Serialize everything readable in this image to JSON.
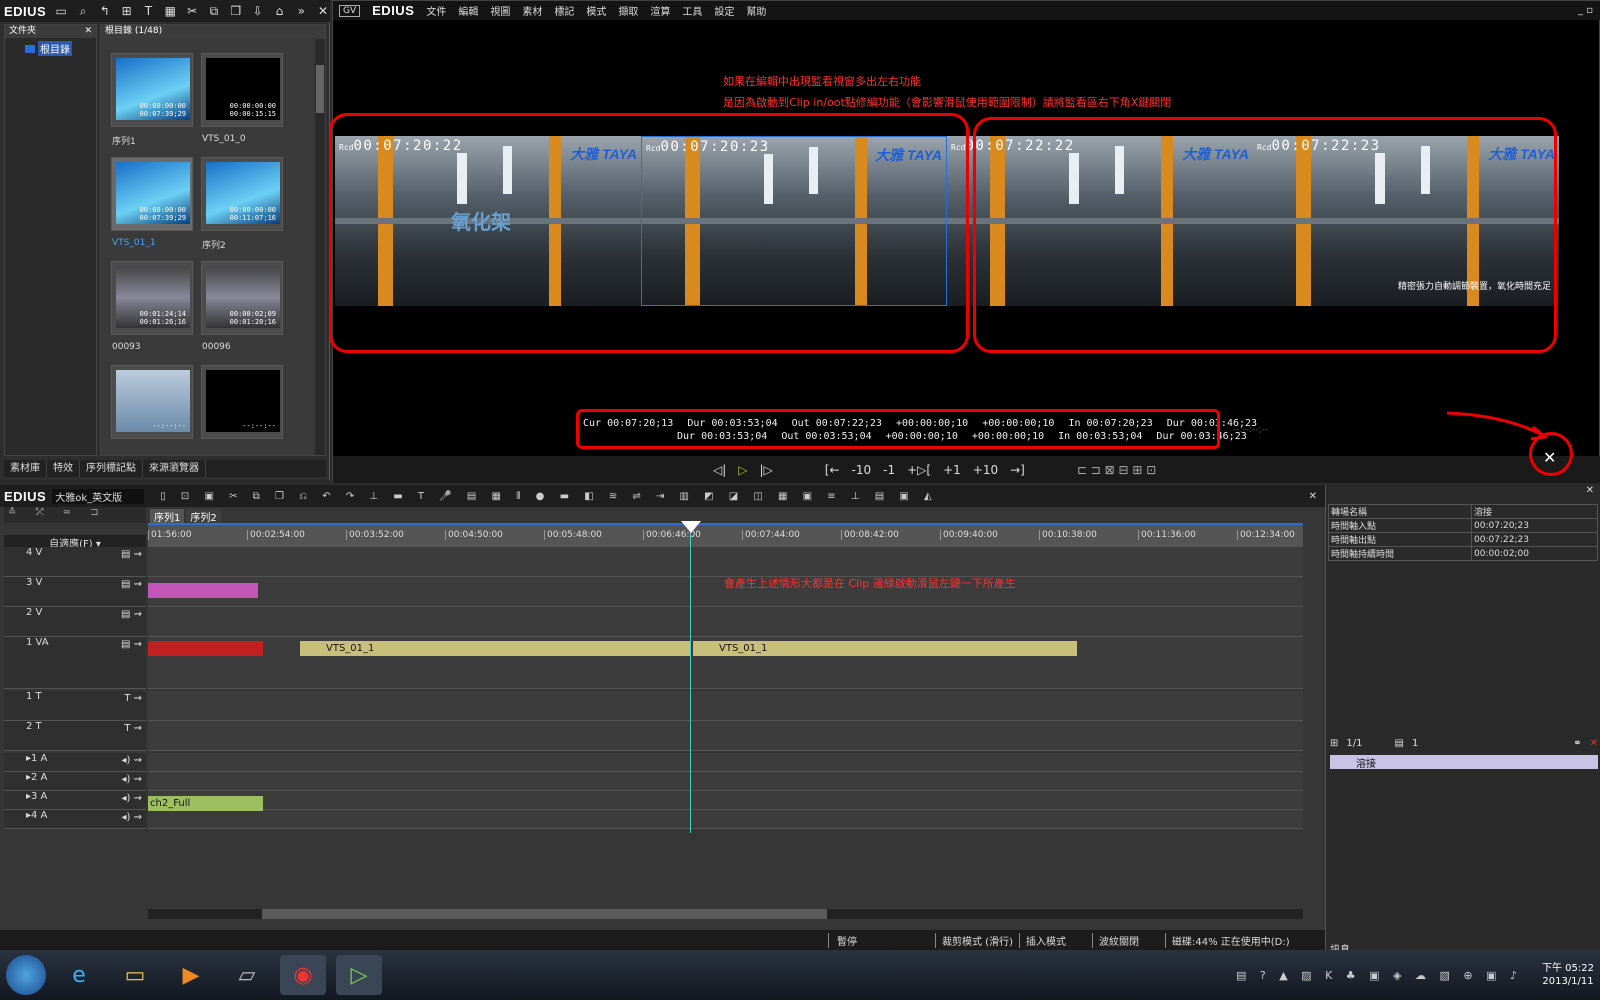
{
  "bin": {
    "logo": "EDIUS",
    "folder_header": "文件夾",
    "root_folder": "根目錄",
    "clip_header": "根目錄 (1/48)",
    "clips": [
      {
        "label": "序列1",
        "tc": "00:00:00:00\n00:07:39;29",
        "kind": "seq"
      },
      {
        "label": "VTS_01_0",
        "tc": "00:00:00:00\n00:00:15:15",
        "kind": "dark"
      },
      {
        "label": "VTS_01_1",
        "tc": "00:00:00:00\n00:07:39;29",
        "kind": "blue",
        "selected": true
      },
      {
        "label": "序列2",
        "tc": "00:00:00:00\n00:11:07;16",
        "kind": "seq"
      },
      {
        "label": "00093",
        "tc": "00:01:24;14\n00:01:26;16",
        "kind": "photo"
      },
      {
        "label": "00096",
        "tc": "00:00:02;09\n00:01:20;16",
        "kind": "photo"
      },
      {
        "label": "",
        "tc": "--:--:--",
        "kind": "still"
      },
      {
        "label": "",
        "tc": "--:--:--",
        "kind": "title"
      }
    ],
    "tabs": [
      "素材庫",
      "特效",
      "序列標記點",
      "來源瀏覽器"
    ]
  },
  "recorder": {
    "logo": "EDIUS",
    "menus": [
      "文件",
      "編輯",
      "視圖",
      "素材",
      "標記",
      "模式",
      "擷取",
      "渲算",
      "工具",
      "設定",
      "幫助"
    ],
    "note_line1": "如果在編輯中出現監看視窗多出左右功能",
    "note_line2": "是因為啟動到Clip in/oot點修編功能（會影響滑鼠使用範圍限制）請將監看區右下角X鍵關閉",
    "frames": [
      {
        "rcd": "Rcd",
        "tc": "00:07:20:22",
        "logo": "大雅 TAYA",
        "overlay": "氧化架",
        "caption": ""
      },
      {
        "rcd": "Rcd",
        "tc": "00:07:20:23",
        "logo": "大雅 TAYA",
        "overlay": "",
        "caption": ""
      },
      {
        "rcd": "Rcd",
        "tc": "00:07:22:22",
        "logo": "大雅 TAYA",
        "overlay": "",
        "caption": ""
      },
      {
        "rcd": "Rcd",
        "tc": "00:07:22:23",
        "logo": "大雅 TAYA",
        "overlay": "",
        "caption": "精密張力自動調節裝置，氧化時間充足"
      }
    ],
    "tc_rows": [
      [
        "Cur 00:07:20;13",
        "Dur 00:03:53;04",
        "Out 00:07:22;23",
        "+00:00:00;10",
        "+00:00:00;10",
        "In 00:07:20;23",
        "Dur 00:03:46;23"
      ],
      [
        "",
        "Dur 00:03:53;04",
        "Out 00:03:53;04",
        "+00:00:00;10",
        "+00:00:00;10",
        "In 00:03:53;04",
        "Dur 00:03:46;23"
      ]
    ],
    "tc_tail": "--:--:--;--",
    "transport": [
      "◁|",
      "▷",
      "|▷",
      "[←",
      "-10",
      "-1",
      "+▷[",
      "+1",
      "+10",
      "→]"
    ],
    "close": "✕"
  },
  "timeline": {
    "logo": "EDIUS",
    "project": "大雅ok_英文版",
    "tabs": [
      "序列1",
      "序列2"
    ],
    "fit": "自適應(F)",
    "ruler": [
      "01:56:00",
      "00:02:54:00",
      "00:03:52:00",
      "00:04:50:00",
      "00:05:48:00",
      "00:06:46:00",
      "00:07:44:00",
      "00:08:42:00",
      "00:09:40:00",
      "00:10:38:00",
      "00:11:36:00",
      "00:12:34:00"
    ],
    "note": "會產生上述情形大都是在 Clip 邊緣啟動滑鼠左鍵一下所產生",
    "tracks": [
      "4 V",
      "3 V",
      "2 V",
      "1 VA",
      "1 T",
      "2 T",
      "▸1 A",
      "▸2 A",
      "▸3 A",
      "▸4 A"
    ],
    "clips": [
      "VTS_01_1",
      "VTS_01_1",
      "ch2_Full"
    ]
  },
  "info": {
    "rows": [
      [
        "轉場名稱",
        "溶接"
      ],
      [
        "時間軸入點",
        "00:07:20;23"
      ],
      [
        "時間軸出點",
        "00:07:22;23"
      ],
      [
        "時間軸持續時間",
        "00:00:02;00"
      ]
    ],
    "page": "1/1",
    "count": "1",
    "item": "溶接",
    "tab": "訊息"
  },
  "status": {
    "items": [
      "暫停",
      "裁剪模式 (滑行)",
      "插入模式",
      "波紋關閉",
      "磁碟:44% 正在使用中(D:)"
    ]
  },
  "taskbar": {
    "time": "下午 05:22",
    "date": "2013/1/11"
  },
  "colors": {
    "annotation": "#ee1111",
    "accent_blue": "#2a6fd6",
    "clip_yellow": "#c8c07a",
    "clip_pink": "#c356b8",
    "clip_green": "#9cc060"
  }
}
